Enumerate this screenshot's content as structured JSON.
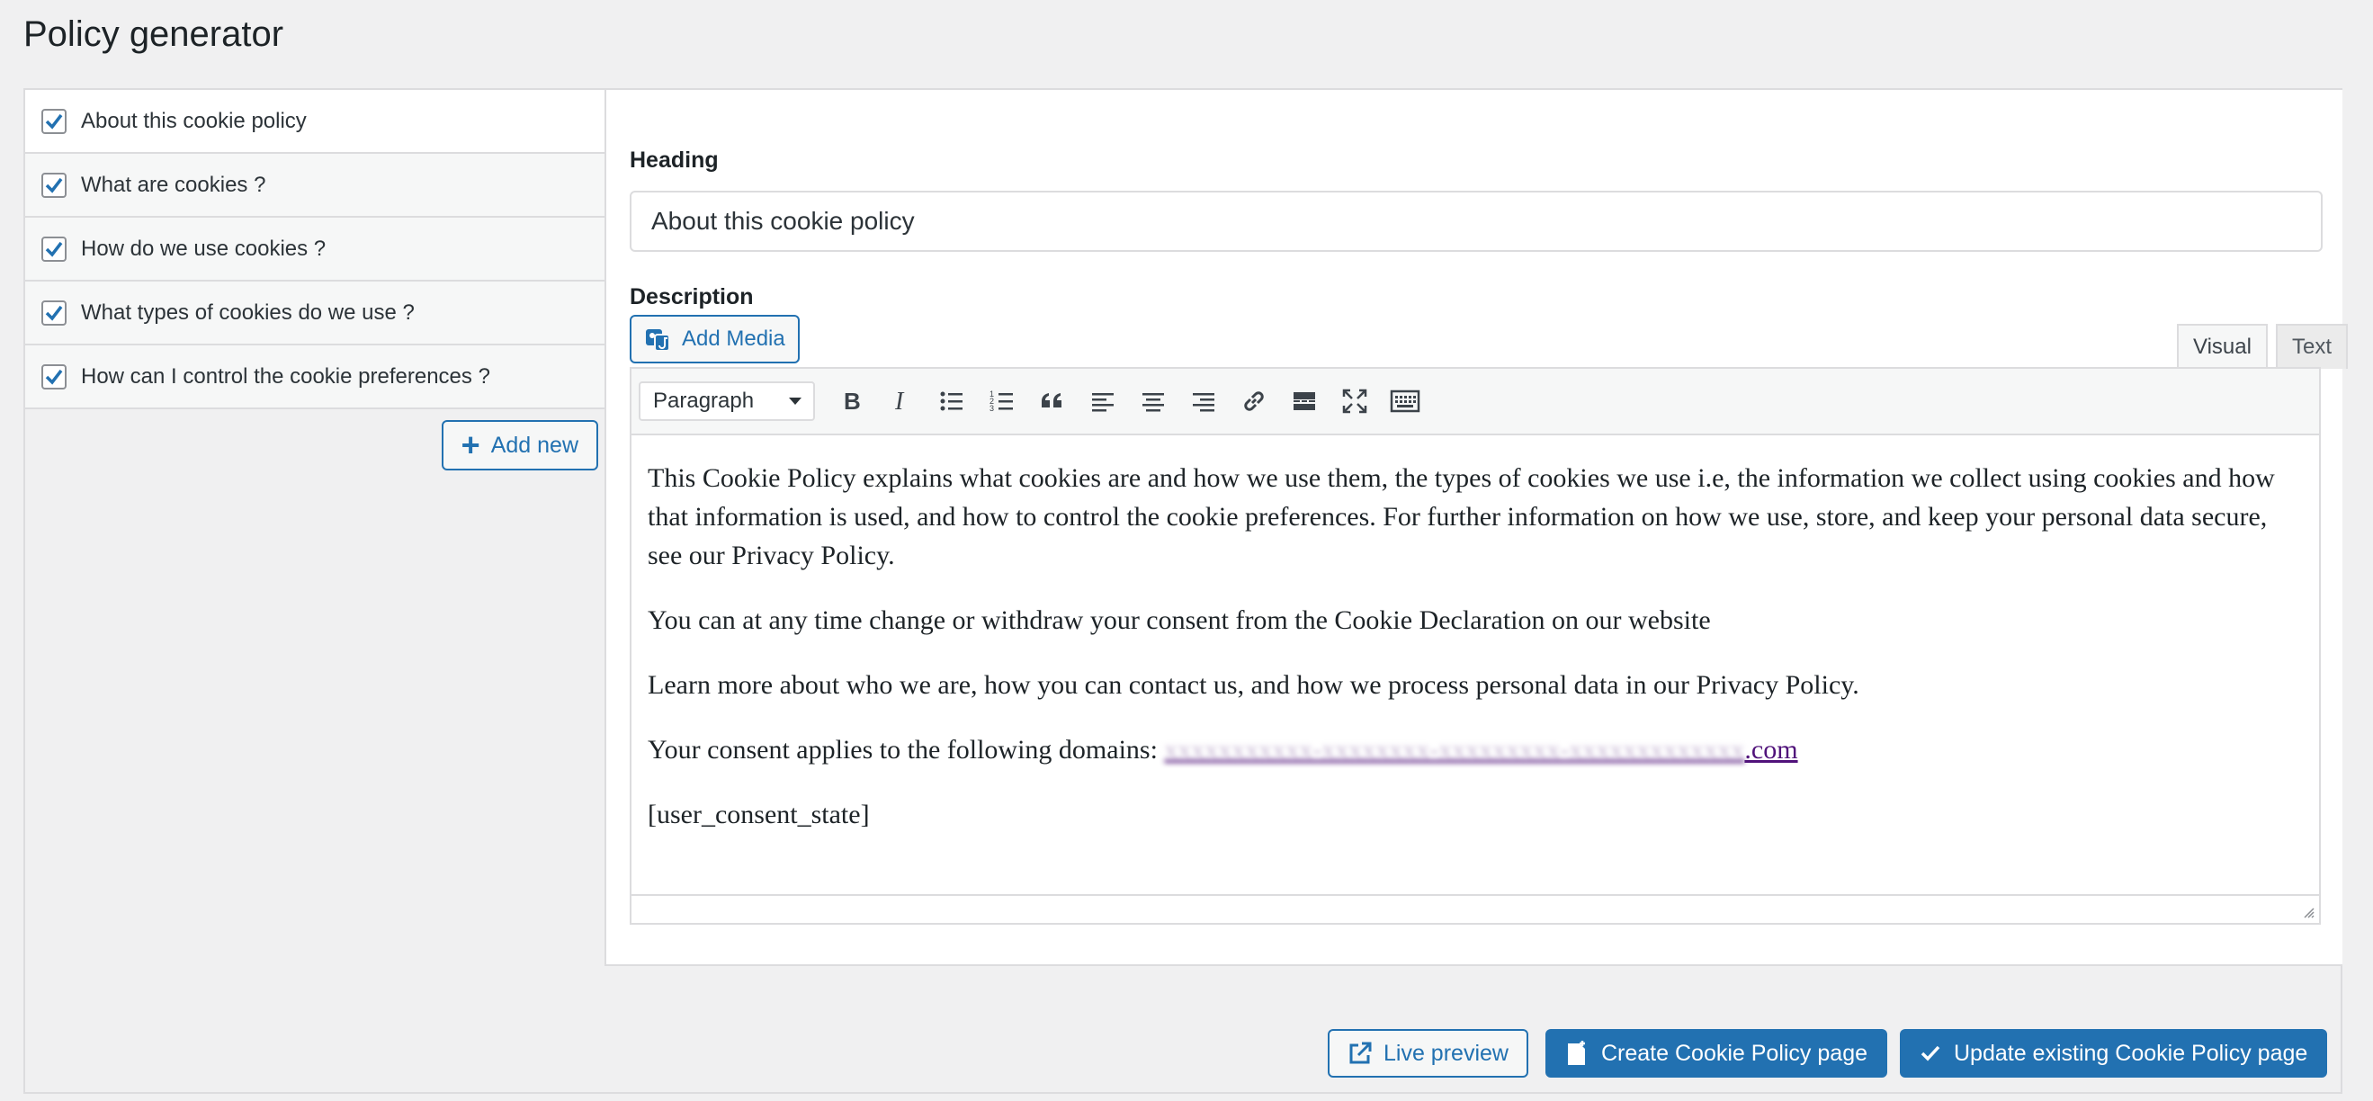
{
  "page_title": "Policy generator",
  "sidebar": {
    "items": [
      {
        "label": "About this cookie policy",
        "checked": true,
        "active": true
      },
      {
        "label": "What are cookies ?",
        "checked": true,
        "active": false
      },
      {
        "label": "How do we use cookies ?",
        "checked": true,
        "active": false
      },
      {
        "label": "What types of cookies do we use ?",
        "checked": true,
        "active": false
      },
      {
        "label": "How can I control the cookie preferences ?",
        "checked": true,
        "active": false
      }
    ],
    "add_new_label": "Add new"
  },
  "main": {
    "heading_label": "Heading",
    "heading_value": "About this cookie policy",
    "description_label": "Description",
    "add_media_label": "Add Media",
    "tabs": [
      {
        "label": "Visual"
      },
      {
        "label": "Text"
      }
    ],
    "format_select_value": "Paragraph",
    "toolbar_icons": [
      "bold-icon",
      "italic-icon",
      "bullet-list-icon",
      "numbered-list-icon",
      "blockquote-icon",
      "align-left-icon",
      "align-center-icon",
      "align-right-icon",
      "link-icon",
      "read-more-icon",
      "fullscreen-icon",
      "toolbar-toggle-icon"
    ],
    "content": {
      "p1": "This Cookie Policy explains what cookies are and how we use them, the types of cookies we use i.e, the information we collect using cookies and how that information is used, and how to control the cookie preferences. For further information on how we use, store, and keep your personal data secure, see our Privacy Policy.",
      "p2": "You can at any time change or withdraw your consent from the Cookie Declaration on our website",
      "p3": "Learn more about who we are, how you can contact us, and how we process personal data in our Privacy Policy.",
      "p4_prefix": "Your consent applies to the following domains: ",
      "p4_domain_blurred": "xxxxxxxxxxx-xxxxxxxx-xxxxxxxxx-xxxxxxxxxxxxx",
      "p4_domain_suffix": ".com",
      "p5": "[user_consent_state]"
    }
  },
  "actions": {
    "live_preview_label": "Live preview",
    "create_label": "Create Cookie Policy page",
    "update_label": "Update existing Cookie Policy page"
  },
  "colors": {
    "primary": "#2271b1",
    "border": "#dcdcde",
    "background": "#f0f0f1",
    "link": "#50127a"
  }
}
